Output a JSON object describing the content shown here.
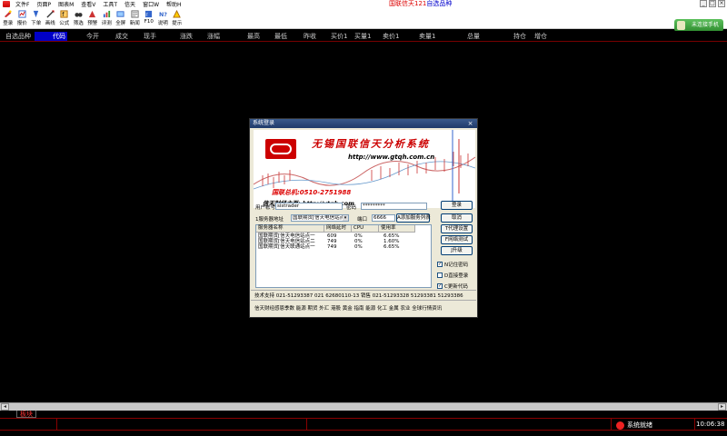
{
  "menu": {
    "items": [
      "文件F",
      "页面P",
      "图表M",
      "查看V",
      "工具T",
      "信天",
      "窗口W",
      "帮助H"
    ],
    "title_red": "国联信天121",
    "title_blue": "自选品种"
  },
  "toolbar": {
    "items": [
      {
        "label": "登录",
        "icon": "login-icon"
      },
      {
        "label": "报价",
        "icon": "quote-icon"
      },
      {
        "label": "下单",
        "icon": "order-icon"
      },
      {
        "label": "画线",
        "icon": "drawline-icon"
      },
      {
        "label": "公式",
        "icon": "formula-icon"
      },
      {
        "label": "筛选",
        "icon": "filter-icon"
      },
      {
        "label": "预警",
        "icon": "alert-icon"
      },
      {
        "label": "评测",
        "icon": "test-icon"
      },
      {
        "label": "全屏",
        "icon": "fullscreen-icon"
      },
      {
        "label": "新闻",
        "icon": "news-icon"
      },
      {
        "label": "F10",
        "icon": "f10-icon"
      },
      {
        "label": "说明",
        "icon": "help-icon"
      },
      {
        "label": "提示",
        "icon": "hint-icon"
      }
    ],
    "connect_label": "未连接手机"
  },
  "columns": {
    "first": "自选品种",
    "selected": "代码",
    "rest": [
      {
        "label": "今开"
      },
      {
        "label": "成交"
      },
      {
        "label": "现手"
      },
      {
        "label": "涨跌"
      },
      {
        "label": "涨幅"
      },
      {
        "label": "最高"
      },
      {
        "label": "最低"
      },
      {
        "label": "昨收"
      },
      {
        "label": "买价1"
      },
      {
        "label": "买量1"
      },
      {
        "label": "卖价1"
      },
      {
        "label": "卖量1"
      },
      {
        "label": "总量"
      },
      {
        "label": "持仓"
      },
      {
        "label": "增仓"
      }
    ]
  },
  "bottom": {
    "tab": "板块",
    "status": "系统就绪",
    "time": "10:06:38"
  },
  "dialog": {
    "title": "系统登录",
    "banner_title": "无锡国联信天分析系统",
    "banner_url": "http://www.gtqh.com.cn",
    "banner_hotline": "国联总机:0510-2751988",
    "banner_home": "信天财经主页:  http://ytqh.com",
    "user_label": "用户帐号",
    "user_value": "sistrader",
    "pwd_label": "密码",
    "pwd_value": "*********",
    "server_label": "1服务器地址",
    "server_value": "国联期货[信天电信站点",
    "port_label": "端口",
    "port_value": "6666",
    "add_server": "A添加服务列表",
    "buttons": {
      "login": "登录",
      "cancel": "取消",
      "proxy": "T代理设置",
      "speed": "F网络测试",
      "upgrade": "J升级"
    },
    "checks": [
      {
        "label": "N记住密码",
        "checked": true
      },
      {
        "label": "D直接登录",
        "checked": false
      },
      {
        "label": "C更新代码",
        "checked": true
      }
    ],
    "list_headers": [
      "服务器名称",
      "网络延时",
      "CPU",
      "使用率"
    ],
    "list_rows": [
      [
        "国联期货[信天电信站点一",
        "609",
        "0%",
        "6.65%"
      ],
      [
        "国联期货[信天电信站点二",
        "749",
        "0%",
        "1.60%"
      ],
      [
        "国联期货[信天联通站点一",
        "749",
        "0%",
        "6.65%"
      ]
    ],
    "support": "技术支持 021-51293387 021 62680110-13 销售 021-51293328 51293381 51293386",
    "ticker": "信天财经感恩季数 能源 期货 外汇 港股 黄金 指南 能源 化工 金属 农业 全球行情资讯"
  }
}
